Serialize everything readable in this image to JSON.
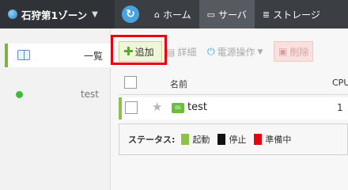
{
  "topbar": {
    "zone_label": "石狩第1ゾーン",
    "nav": [
      {
        "label": "ホーム",
        "icon": "home-icon"
      },
      {
        "label": "サーバ",
        "icon": "monitor-icon",
        "active": true
      },
      {
        "label": "ストレージ",
        "icon": "storage-icon"
      }
    ]
  },
  "sidebar": {
    "header_label": "一覧",
    "items": [
      {
        "name": "test",
        "status": "running"
      }
    ]
  },
  "toolbar": {
    "add_label": "追加",
    "detail_label": "詳細",
    "power_label": "電源操作",
    "delete_label": "削除"
  },
  "table": {
    "columns": {
      "name": "名前",
      "cpu": "CPU"
    },
    "rows": [
      {
        "name": "test",
        "cpu": "1",
        "icon_text": "OS"
      }
    ]
  },
  "legend": {
    "title": "ステータス:",
    "items": [
      {
        "label": "起動",
        "color": "#8bc34a"
      },
      {
        "label": "停止",
        "color": "#111111"
      },
      {
        "label": "準備中",
        "color": "#e8000f"
      }
    ]
  }
}
